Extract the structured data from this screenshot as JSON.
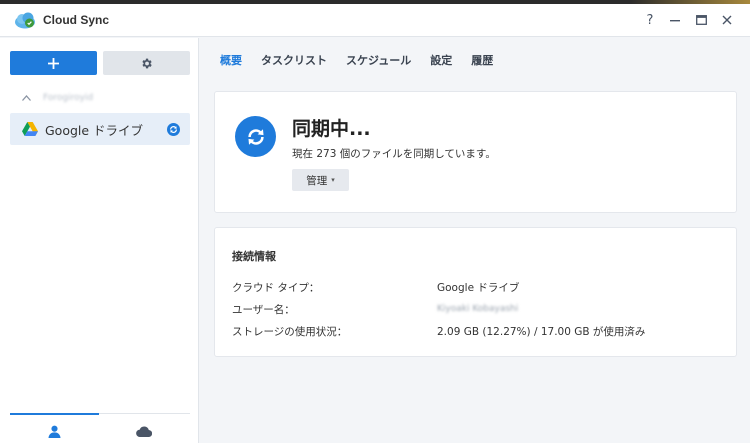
{
  "window": {
    "title": "Cloud Sync",
    "controls": {
      "help": "?",
      "minimize": "—",
      "maximize": "▭",
      "close": "✕"
    }
  },
  "sidebar": {
    "account_name": "Forogiroyid",
    "task": {
      "label": "Google ドライブ"
    }
  },
  "tabs": [
    {
      "label": "概要",
      "active": true
    },
    {
      "label": "タスクリスト",
      "active": false
    },
    {
      "label": "スケジュール",
      "active": false
    },
    {
      "label": "設定",
      "active": false
    },
    {
      "label": "履歴",
      "active": false
    }
  ],
  "status": {
    "title": "同期中...",
    "subtitle": "現在 273 個のファイルを同期しています。",
    "manage_label": "管理"
  },
  "connection": {
    "heading": "接続情報",
    "rows": [
      {
        "key": "クラウド タイプ：",
        "value": "Google ドライブ"
      },
      {
        "key": "ユーザー名：",
        "value": "Kiyoaki Kobayashi"
      },
      {
        "key": "ストレージの使用状況：",
        "value": "2.09 GB (12.27%) / 17.00 GB が使用済み"
      }
    ]
  },
  "colors": {
    "accent": "#1f7bdb",
    "selected_bg": "#e6eef8"
  }
}
